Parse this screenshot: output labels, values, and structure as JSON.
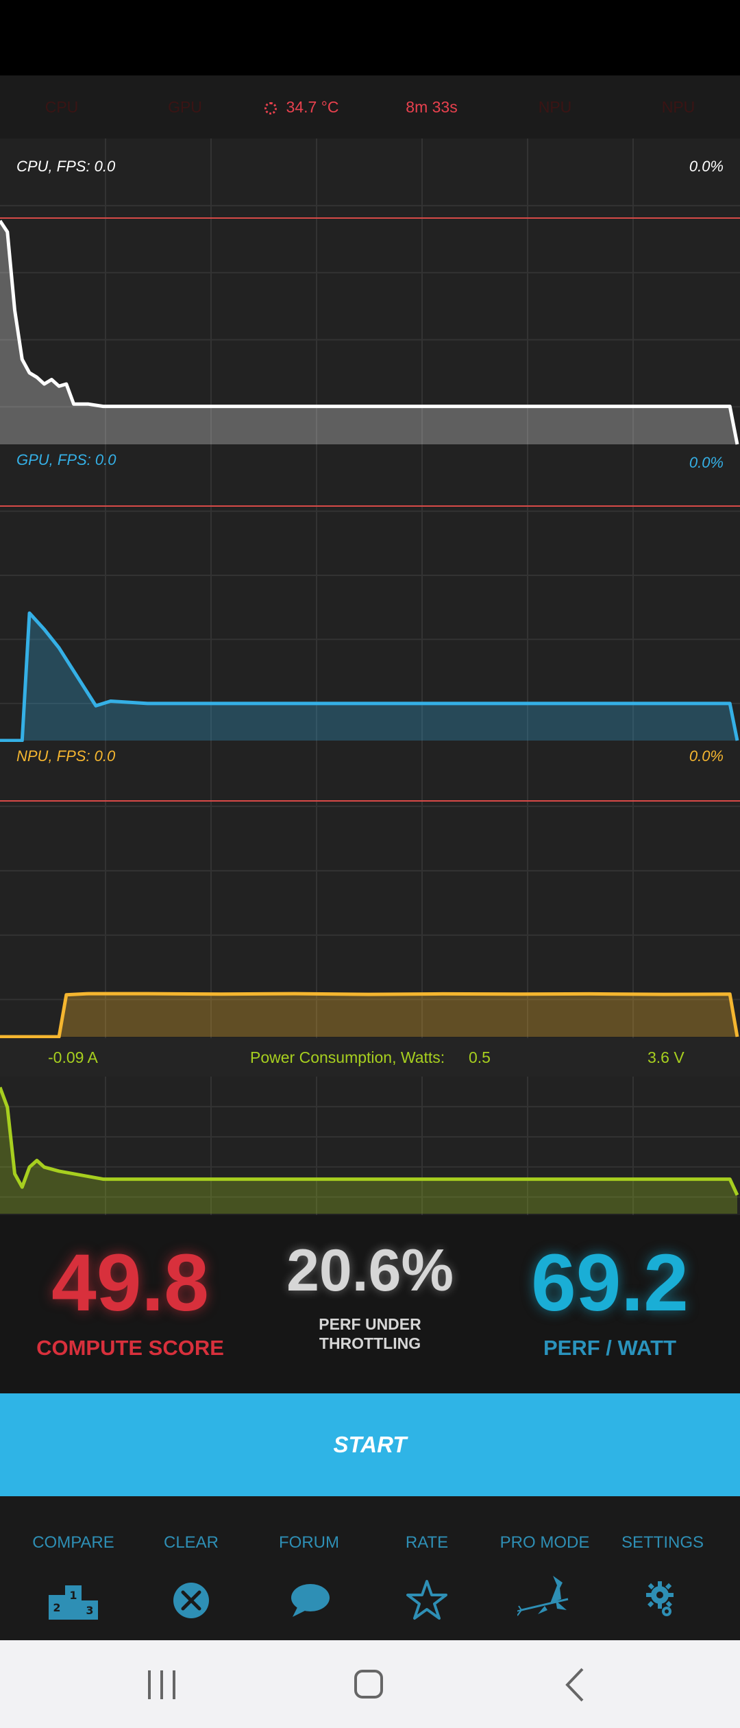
{
  "topbar": {
    "items": [
      "CPU",
      "GPU",
      "34.7 °C",
      "8m 33s",
      "NPU",
      "NPU"
    ]
  },
  "panels": {
    "cpu": {
      "label": "CPU, FPS:  0.0",
      "percent": "0.0%",
      "color": "#ffffff"
    },
    "gpu": {
      "label": "GPU, FPS:  0.0",
      "percent": "0.0%",
      "color": "#35b0e6"
    },
    "npu": {
      "label": "NPU, FPS:  0.0",
      "percent": "0.0%",
      "color": "#f5b630"
    }
  },
  "power": {
    "current": "-0.09 A",
    "label": "Power Consumption, Watts:",
    "value": "0.5",
    "voltage": "3.6 V",
    "color": "#a7cf1f"
  },
  "scores": {
    "compute": {
      "value": "49.8",
      "label": "COMPUTE SCORE",
      "color": "#d8303c"
    },
    "throttle": {
      "value": "20.6%",
      "label_line1": "PERF UNDER",
      "label_line2": "THROTTLING",
      "color": "#d6d6d6"
    },
    "perfwatt": {
      "value": "69.2",
      "label": "PERF / WATT",
      "color": "#1aaed6"
    }
  },
  "start": {
    "label": "START",
    "color": "#2fb4e6"
  },
  "toolbar": {
    "compare": "COMPARE",
    "clear": "CLEAR",
    "forum": "FORUM",
    "rate": "RATE",
    "pro_mode": "PRO MODE",
    "settings": "SETTINGS"
  },
  "icons": {
    "compare": "podium-icon",
    "clear": "close-circle-icon",
    "forum": "chat-bubble-icon",
    "rate": "star-icon",
    "pro_mode": "witch-icon",
    "settings": "gear-icon"
  },
  "series": {
    "cpu": [
      [
        0,
        100
      ],
      [
        1,
        95
      ],
      [
        2,
        60
      ],
      [
        3,
        38
      ],
      [
        4,
        32
      ],
      [
        5,
        30
      ],
      [
        6,
        27
      ],
      [
        7,
        29
      ],
      [
        8,
        26
      ],
      [
        9,
        27
      ],
      [
        10,
        18
      ],
      [
        12,
        18
      ],
      [
        14,
        17
      ],
      [
        16,
        17
      ],
      [
        20,
        17
      ],
      [
        30,
        17
      ],
      [
        40,
        17
      ],
      [
        50,
        17
      ],
      [
        60,
        17
      ],
      [
        70,
        17
      ],
      [
        80,
        17
      ],
      [
        90,
        17
      ],
      [
        99,
        17
      ],
      [
        100,
        0
      ]
    ],
    "gpu": [
      [
        0,
        0
      ],
      [
        3,
        0
      ],
      [
        4,
        55
      ],
      [
        6,
        48
      ],
      [
        8,
        40
      ],
      [
        10,
        30
      ],
      [
        13,
        15
      ],
      [
        15,
        17
      ],
      [
        20,
        16
      ],
      [
        30,
        16
      ],
      [
        40,
        16
      ],
      [
        50,
        16
      ],
      [
        60,
        16
      ],
      [
        70,
        16
      ],
      [
        80,
        16
      ],
      [
        90,
        16
      ],
      [
        99,
        16
      ],
      [
        100,
        0
      ]
    ],
    "npu": [
      [
        0,
        0
      ],
      [
        8,
        0
      ],
      [
        9,
        18
      ],
      [
        12,
        18.5
      ],
      [
        20,
        18.5
      ],
      [
        30,
        18.3
      ],
      [
        40,
        18.5
      ],
      [
        50,
        18.2
      ],
      [
        60,
        18.4
      ],
      [
        70,
        18.3
      ],
      [
        80,
        18.4
      ],
      [
        90,
        18.2
      ],
      [
        99,
        18.3
      ],
      [
        100,
        0
      ]
    ],
    "power": [
      [
        0,
        95
      ],
      [
        1,
        80
      ],
      [
        2,
        30
      ],
      [
        3,
        20
      ],
      [
        4,
        35
      ],
      [
        5,
        40
      ],
      [
        6,
        35
      ],
      [
        8,
        32
      ],
      [
        10,
        30
      ],
      [
        12,
        28
      ],
      [
        14,
        26
      ],
      [
        16,
        26
      ],
      [
        20,
        26
      ],
      [
        30,
        26
      ],
      [
        40,
        26
      ],
      [
        50,
        26
      ],
      [
        60,
        26
      ],
      [
        70,
        26
      ],
      [
        80,
        26
      ],
      [
        90,
        26
      ],
      [
        99,
        26
      ],
      [
        100,
        14
      ]
    ]
  }
}
